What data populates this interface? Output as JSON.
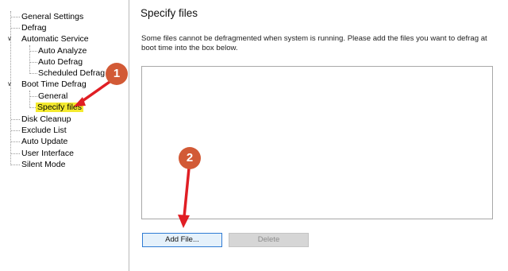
{
  "tree": {
    "items": [
      {
        "label": "General Settings"
      },
      {
        "label": "Defrag"
      },
      {
        "label": "Automatic Service"
      },
      {
        "label": "Auto Analyze"
      },
      {
        "label": "Auto Defrag"
      },
      {
        "label": "Scheduled Defrag"
      },
      {
        "label": "Boot Time Defrag"
      },
      {
        "label": "General"
      },
      {
        "label": "Specify files"
      },
      {
        "label": "Disk Cleanup"
      },
      {
        "label": "Exclude List"
      },
      {
        "label": "Auto Update"
      },
      {
        "label": "User Interface"
      },
      {
        "label": "Silent Mode"
      }
    ],
    "selected": "Specify files",
    "highlight_color": "#f4ea2e"
  },
  "panel": {
    "title": "Specify files",
    "description": "Some files cannot be defragmented when system is running. Please add the files you want to defrag at boot time into the box below.",
    "add_button": "Add File...",
    "delete_button": "Delete"
  },
  "annotations": {
    "badge_1": "1",
    "badge_2": "2",
    "badge_color": "#d25a36",
    "arrow_color": "#e01e24"
  }
}
